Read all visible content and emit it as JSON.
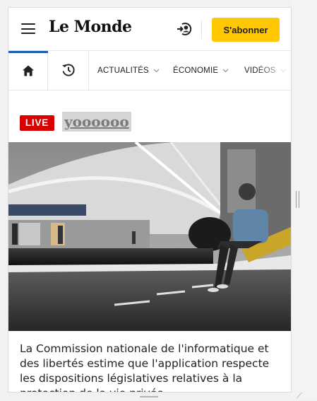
{
  "header": {
    "logo": "Le Monde",
    "subscribe_label": "S'abonner"
  },
  "nav": {
    "tabs": [
      {
        "label": "ACTUALITÉS"
      },
      {
        "label": "ÉCONOMIE"
      },
      {
        "label": "VIDÉOS"
      }
    ]
  },
  "live": {
    "badge": "LIVE",
    "title": "yoooooo"
  },
  "article": {
    "caption": "La Commission nationale de l'informatique et des libertés estime que l'application respecte les dispositions législatives relatives à la protection de la vie privée."
  },
  "colors": {
    "brand_yellow": "#ffc800",
    "live_red": "#d80000",
    "active_blue": "#1a5fae"
  },
  "icons": [
    "menu-icon",
    "account-icon",
    "home-icon",
    "history-icon",
    "chevron-down-icon"
  ]
}
